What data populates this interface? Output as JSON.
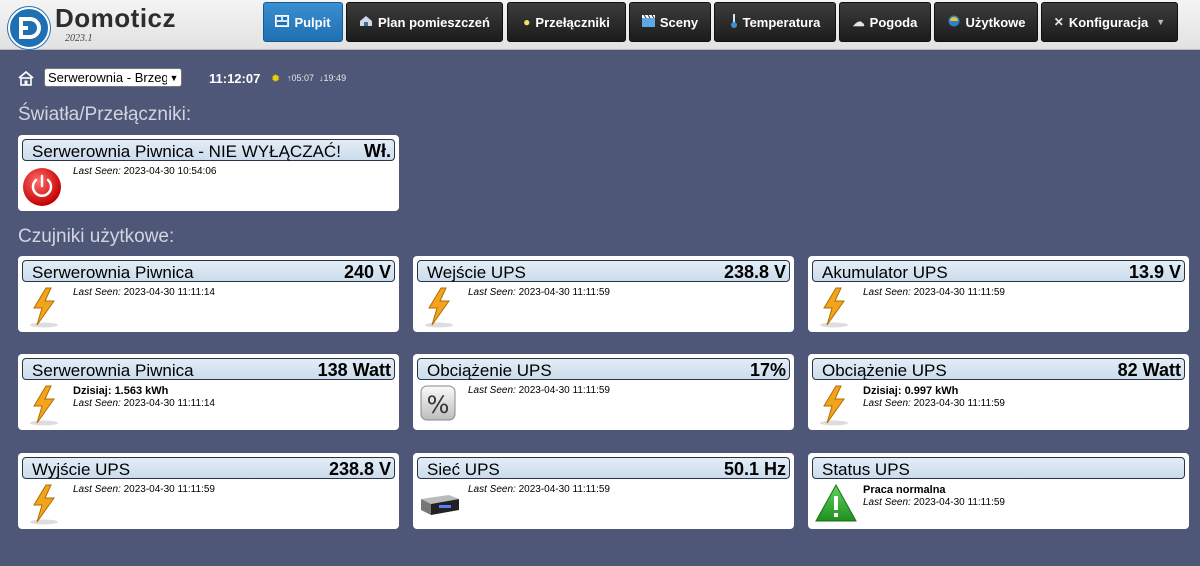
{
  "app": {
    "name": "Domoticz",
    "version": "2023.1"
  },
  "nav": [
    {
      "label": "Pulpit",
      "icon": "dashboard-icon",
      "active": true
    },
    {
      "label": "Plan pomieszczeń",
      "icon": "floorplan-icon"
    },
    {
      "label": "Przełączniki",
      "icon": "lightbulb-icon"
    },
    {
      "label": "Sceny",
      "icon": "scenes-icon"
    },
    {
      "label": "Temperatura",
      "icon": "thermometer-icon"
    },
    {
      "label": "Pogoda",
      "icon": "weather-icon"
    },
    {
      "label": "Użytkowe",
      "icon": "utility-icon"
    },
    {
      "label": "Konfiguracja",
      "icon": "tools-icon"
    }
  ],
  "toolbar": {
    "room_value": "Serwerownia - Brzeg",
    "time": "11:12:07",
    "sunrise": "↑05:07",
    "sunset": "↓19:49"
  },
  "sections": {
    "switches": "Światła/Przełączniki:",
    "utility": "Czujniki użytkowe:"
  },
  "last_seen_label": "Last Seen:",
  "switch_cards": [
    {
      "name": "Serwerownia Piwnica - NIE WYŁĄCZAĆ!",
      "value": "Wł.",
      "last_seen": "2023-04-30 10:54:06",
      "icon": "power-on-icon"
    }
  ],
  "utility_cards": [
    {
      "name": "Serwerownia Piwnica",
      "value": "240 V",
      "last_seen": "2023-04-30 11:11:14",
      "icon": "lightning-icon",
      "extra": ""
    },
    {
      "name": "Wejście UPS",
      "value": "238.8 V",
      "last_seen": "2023-04-30 11:11:59",
      "icon": "lightning-icon",
      "extra": ""
    },
    {
      "name": "Akumulator UPS",
      "value": "13.9 V",
      "last_seen": "2023-04-30 11:11:59",
      "icon": "lightning-icon",
      "extra": ""
    },
    {
      "name": "Serwerownia Piwnica",
      "value": "138 Watt",
      "last_seen": "2023-04-30 11:11:14",
      "icon": "lightning-icon",
      "extra": "Dzisiaj: 1.563 kWh"
    },
    {
      "name": "Obciążenie UPS",
      "value": "17%",
      "last_seen": "2023-04-30 11:11:59",
      "icon": "percent-icon",
      "extra": ""
    },
    {
      "name": "Obciążenie UPS",
      "value": "82 Watt",
      "last_seen": "2023-04-30 11:11:59",
      "icon": "lightning-icon",
      "extra": "Dzisiaj: 0.997 kWh"
    },
    {
      "name": "Wyjście UPS",
      "value": "238.8 V",
      "last_seen": "2023-04-30 11:11:59",
      "icon": "lightning-icon",
      "extra": ""
    },
    {
      "name": "Sieć UPS",
      "value": "50.1 Hz",
      "last_seen": "2023-04-30 11:11:59",
      "icon": "device-box-icon",
      "extra": ""
    },
    {
      "name": "Status UPS",
      "value": "",
      "last_seen": "2023-04-30 11:11:59",
      "icon": "alert-triangle-icon",
      "extra": "Praca normalna"
    }
  ]
}
